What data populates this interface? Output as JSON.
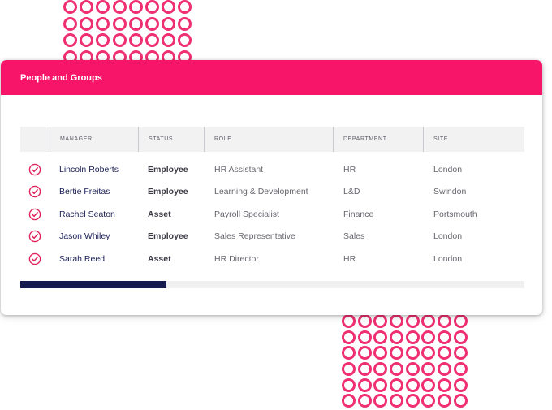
{
  "panel": {
    "title": "People and Groups"
  },
  "table": {
    "columns": {
      "manager": "MANAGER",
      "status": "STATUS",
      "role": "ROLE",
      "department": "DEPARTMENT",
      "site": "SITE"
    },
    "rows": [
      {
        "manager": "Lincoln Roberts",
        "status": "Employee",
        "role": "HR Assistant",
        "department": "HR",
        "site": "London"
      },
      {
        "manager": "Bertie Freitas",
        "status": "Employee",
        "role": "Learning & Development",
        "department": "L&D",
        "site": "Swindon"
      },
      {
        "manager": "Rachel Seaton",
        "status": "Asset",
        "role": "Payroll Specialist",
        "department": "Finance",
        "site": "Portsmouth"
      },
      {
        "manager": "Jason Whiley",
        "status": "Employee",
        "role": "Sales Representative",
        "department": "Sales",
        "site": "London"
      },
      {
        "manager": "Sarah Reed",
        "status": "Asset",
        "role": "HR Director",
        "department": "HR",
        "site": "London"
      }
    ],
    "row_icon": "check-circle-icon"
  },
  "scrollbar": {
    "position_fraction": 0.29
  },
  "decoration": {
    "dot_icon": "ring-icon"
  },
  "colors": {
    "accent": "#f71569",
    "dots": "#ef2f72",
    "manager_text": "#1a1f55",
    "scroll_thumb": "#161b4f",
    "header_bg": "#f2f2f3"
  }
}
